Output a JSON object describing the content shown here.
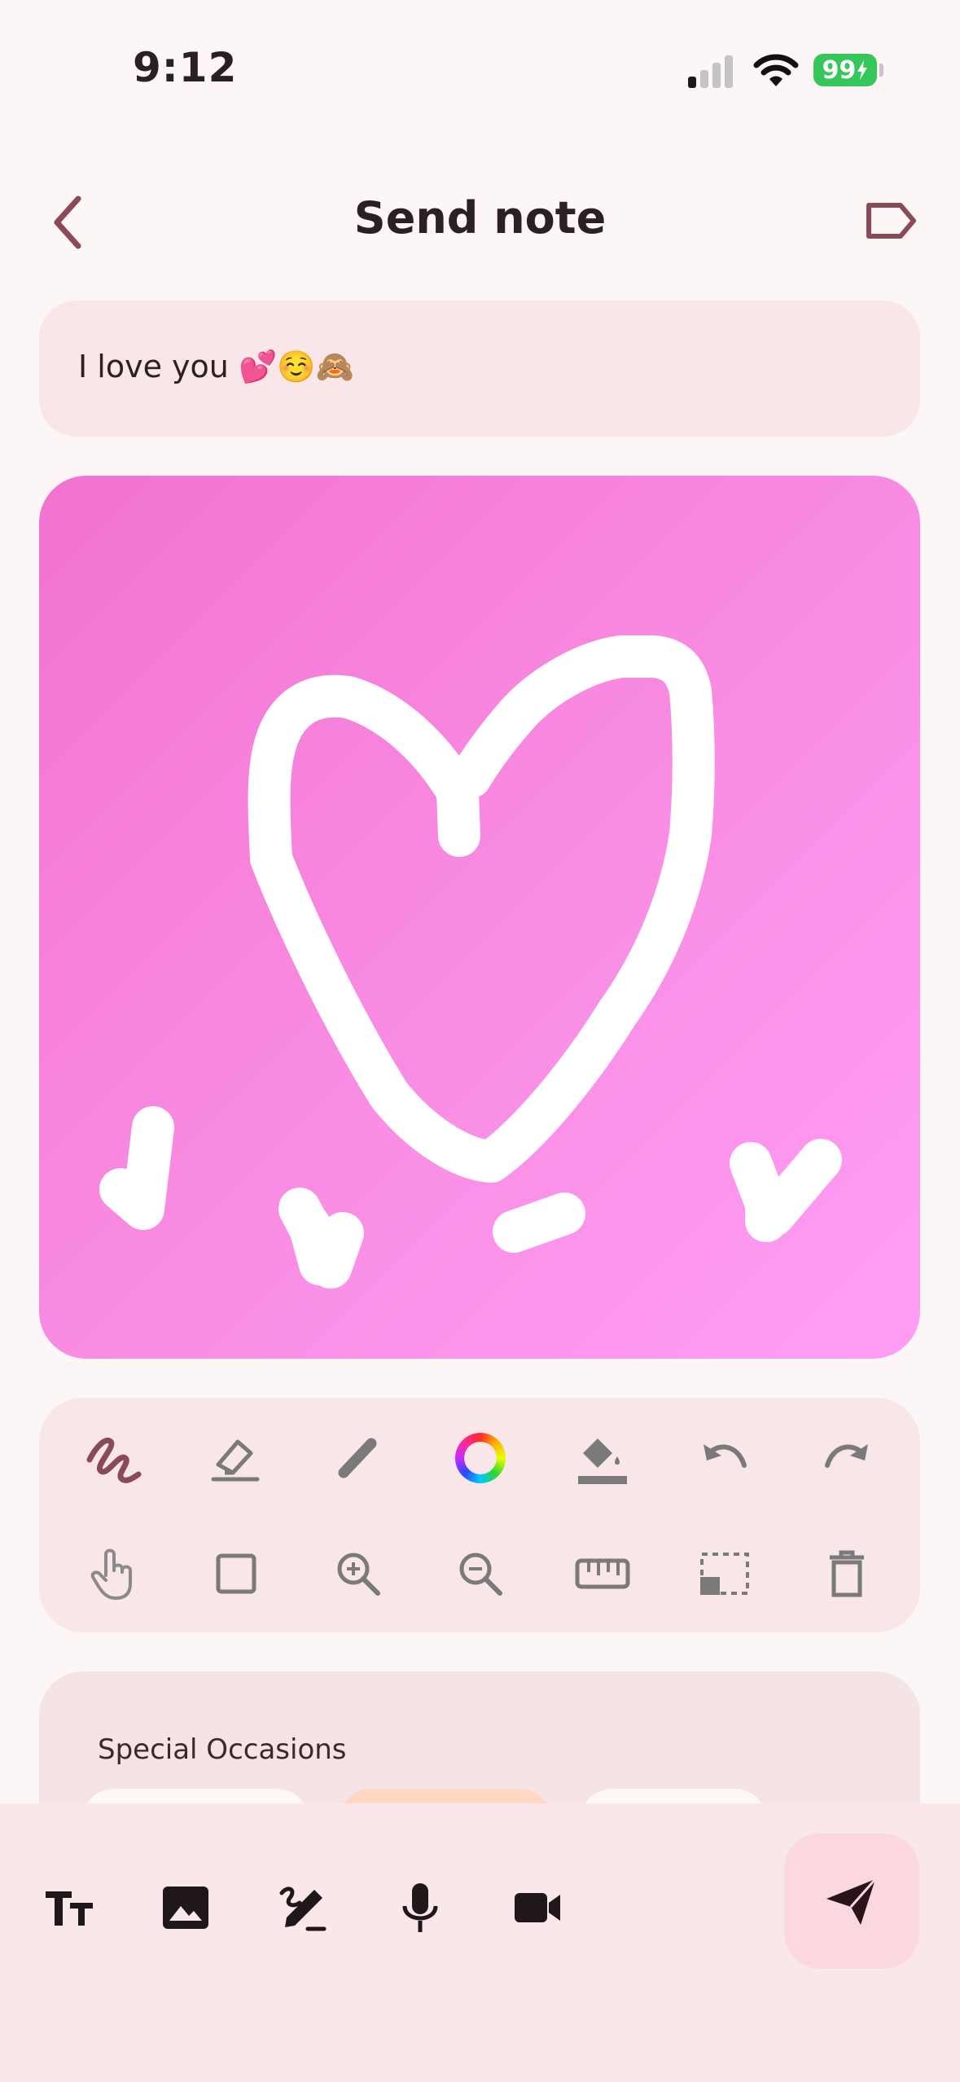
{
  "status_bar": {
    "time": "9:12",
    "battery": "99"
  },
  "header": {
    "title": "Send note"
  },
  "message": {
    "text": "I love you 💕☺️🙈"
  },
  "occasions": {
    "title": "Special Occasions"
  },
  "icons": {
    "back": "chevron-left-icon",
    "tag": "tag-icon",
    "tools_row1": [
      "brush-icon",
      "eraser-icon",
      "pencil-icon",
      "color-wheel-icon",
      "fill-bucket-icon",
      "undo-icon",
      "redo-icon"
    ],
    "tools_row2": [
      "touch-icon",
      "shape-icon",
      "zoom-in-icon",
      "zoom-out-icon",
      "ruler-icon",
      "select-area-icon",
      "trash-icon"
    ],
    "bottom": [
      "text-size-icon",
      "image-icon",
      "handwriting-icon",
      "microphone-icon",
      "video-icon",
      "send-icon"
    ]
  },
  "colors": {
    "accent": "#8a4a58",
    "canvas_start": "#f272cf",
    "canvas_end": "#ff9ef5"
  }
}
